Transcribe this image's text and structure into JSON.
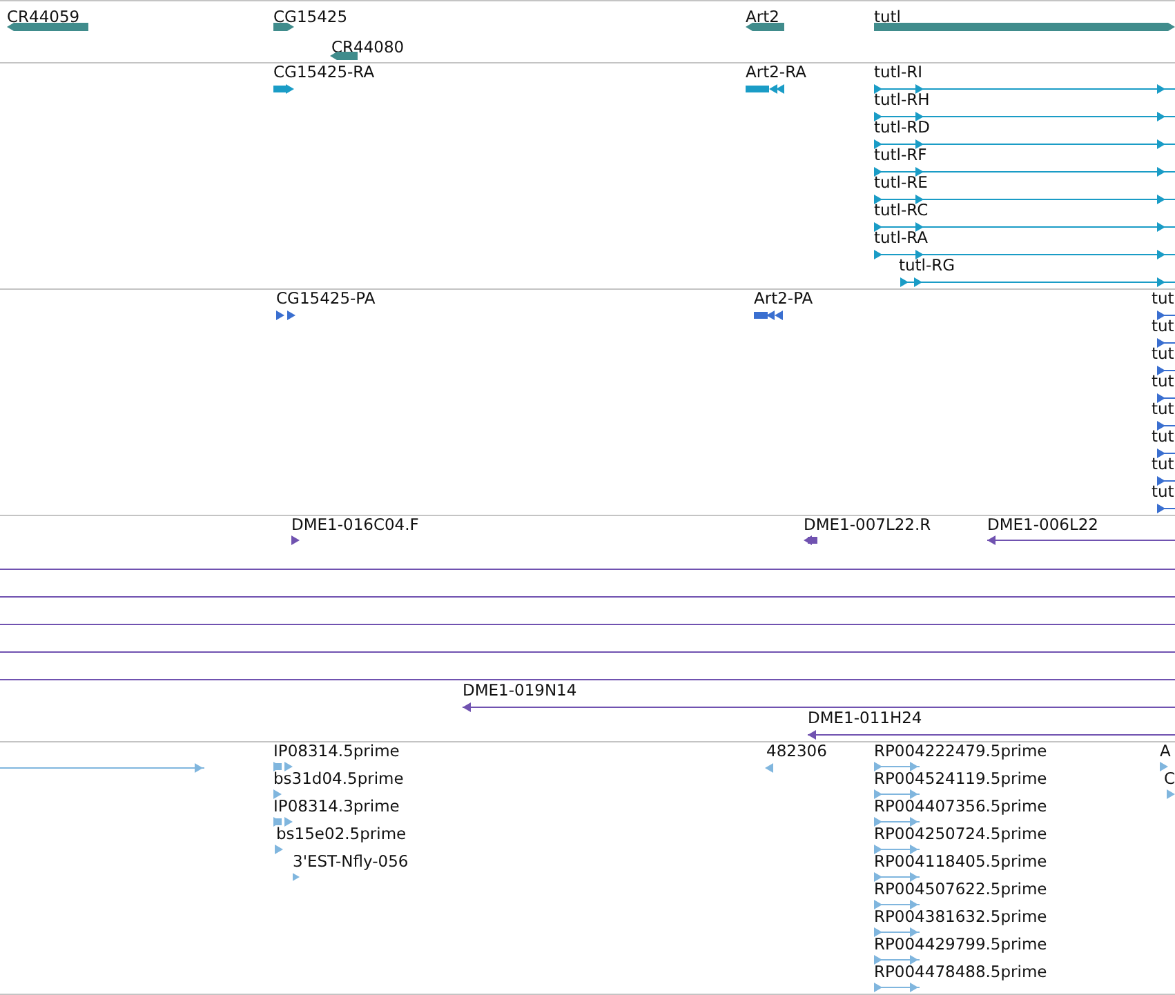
{
  "tracks": [
    {
      "kind": "gene",
      "color": "#408c8c",
      "features": [
        {
          "label": "CR44059",
          "reverse": true
        },
        {
          "label": "CG15425",
          "reverse": false
        },
        {
          "label": "CR44080",
          "reverse": true
        },
        {
          "label": "Art2",
          "reverse": true
        },
        {
          "label": "tutl",
          "reverse": false
        }
      ]
    },
    {
      "kind": "transcript",
      "color": "#1a9cc6",
      "features": [
        {
          "label": "CG15425-RA",
          "reverse": false
        },
        {
          "label": "Art2-RA",
          "reverse": true
        },
        {
          "label": "tutl-RI",
          "reverse": false
        },
        {
          "label": "tutl-RH",
          "reverse": false
        },
        {
          "label": "tutl-RD",
          "reverse": false
        },
        {
          "label": "tutl-RF",
          "reverse": false
        },
        {
          "label": "tutl-RE",
          "reverse": false
        },
        {
          "label": "tutl-RC",
          "reverse": false
        },
        {
          "label": "tutl-RA",
          "reverse": false
        },
        {
          "label": "tutl-RG",
          "reverse": false
        }
      ]
    },
    {
      "kind": "protein",
      "color": "#3a6fd0",
      "features": [
        {
          "label": "CG15425-PA",
          "reverse": false
        },
        {
          "label": "Art2-PA",
          "reverse": true
        },
        {
          "label": "tut",
          "reverse": false
        },
        {
          "label": "tut",
          "reverse": false
        },
        {
          "label": "tut",
          "reverse": false
        },
        {
          "label": "tut",
          "reverse": false
        },
        {
          "label": "tut",
          "reverse": false
        },
        {
          "label": "tut",
          "reverse": false
        },
        {
          "label": "tut",
          "reverse": false
        },
        {
          "label": "tut",
          "reverse": false
        }
      ]
    },
    {
      "kind": "clone",
      "color": "#7052b0",
      "features": [
        {
          "kind": "arrow",
          "label": "DME1-016C04.F",
          "reverse": false
        },
        {
          "kind": "arrow",
          "label": "DME1-007L22.R",
          "reverse": true
        },
        {
          "kind": "arrow",
          "label": "DME1-006L22",
          "reverse": true
        },
        {
          "kind": "plain"
        },
        {
          "kind": "plain"
        },
        {
          "kind": "plain"
        },
        {
          "kind": "plain"
        },
        {
          "kind": "plain"
        },
        {
          "kind": "arrow",
          "label": "DME1-019N14",
          "reverse": true
        },
        {
          "kind": "arrow",
          "label": "DME1-011H24",
          "reverse": true
        }
      ]
    },
    {
      "kind": "est",
      "color": "#80b6de",
      "features": [
        {
          "reverse": false
        },
        {
          "label": "IP08314.5prime",
          "reverse": false
        },
        {
          "label": "bs31d04.5prime",
          "reverse": false
        },
        {
          "label": "IP08314.3prime",
          "reverse": false
        },
        {
          "label": "bs15e02.5prime",
          "reverse": false
        },
        {
          "label": "3'EST-Nfly-056",
          "reverse": false
        },
        {
          "label": "482306",
          "reverse": true
        },
        {
          "label": "RP004222479.5prime",
          "reverse": false
        },
        {
          "label": "RP004524119.5prime",
          "reverse": false
        },
        {
          "label": "RP004407356.5prime",
          "reverse": false
        },
        {
          "label": "RP004250724.5prime",
          "reverse": false
        },
        {
          "label": "RP004118405.5prime",
          "reverse": false
        },
        {
          "label": "RP004507622.5prime",
          "reverse": false
        },
        {
          "label": "RP004381632.5prime",
          "reverse": false
        },
        {
          "label": "RP004429799.5prime",
          "reverse": false
        },
        {
          "label": "RP004478488.5prime",
          "reverse": false
        },
        {
          "label": "A",
          "reverse": false
        },
        {
          "label": "C",
          "reverse": false
        }
      ]
    }
  ]
}
